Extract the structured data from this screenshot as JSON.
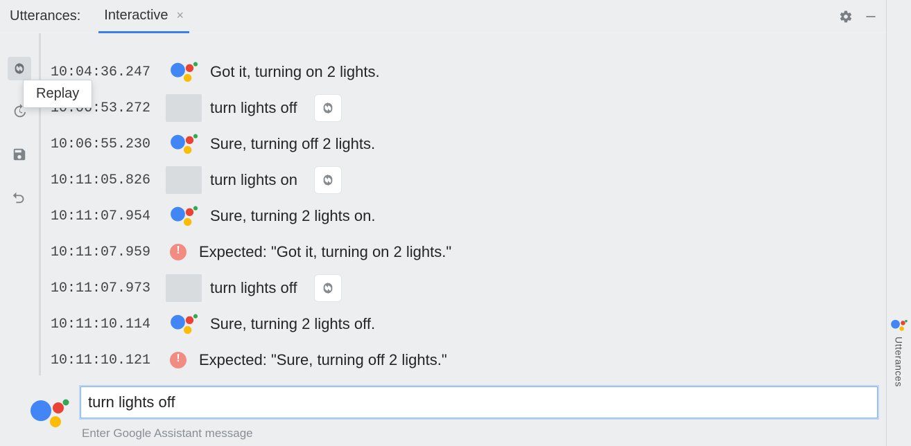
{
  "header": {
    "title_label": "Utterances:",
    "active_tab": "Interactive"
  },
  "tooltip": {
    "replay_label": "Replay"
  },
  "log_rows": [
    {
      "ts": "10:04:36.247",
      "kind": "assistant",
      "text": "Got it, turning on 2 lights."
    },
    {
      "ts": "10:06:53.272",
      "kind": "user",
      "text": "turn lights off",
      "has_replay_inline": true
    },
    {
      "ts": "10:06:55.230",
      "kind": "assistant",
      "text": "Sure, turning off 2 lights."
    },
    {
      "ts": "10:11:05.826",
      "kind": "user",
      "text": "turn lights on",
      "has_replay_inline": true
    },
    {
      "ts": "10:11:07.954",
      "kind": "assistant",
      "text": "Sure, turning 2 lights on."
    },
    {
      "ts": "10:11:07.959",
      "kind": "expected",
      "text": "Expected: \"Got it, turning on 2 lights.\""
    },
    {
      "ts": "10:11:07.973",
      "kind": "user",
      "text": "turn lights off",
      "has_replay_inline": true
    },
    {
      "ts": "10:11:10.114",
      "kind": "assistant",
      "text": "Sure, turning 2 lights off."
    },
    {
      "ts": "10:11:10.121",
      "kind": "expected",
      "text": "Expected: \"Sure, turning off 2 lights.\""
    }
  ],
  "input": {
    "value": "turn lights off",
    "hint": "Enter Google Assistant message"
  },
  "right_rail": {
    "tab_label": "Utterances"
  }
}
